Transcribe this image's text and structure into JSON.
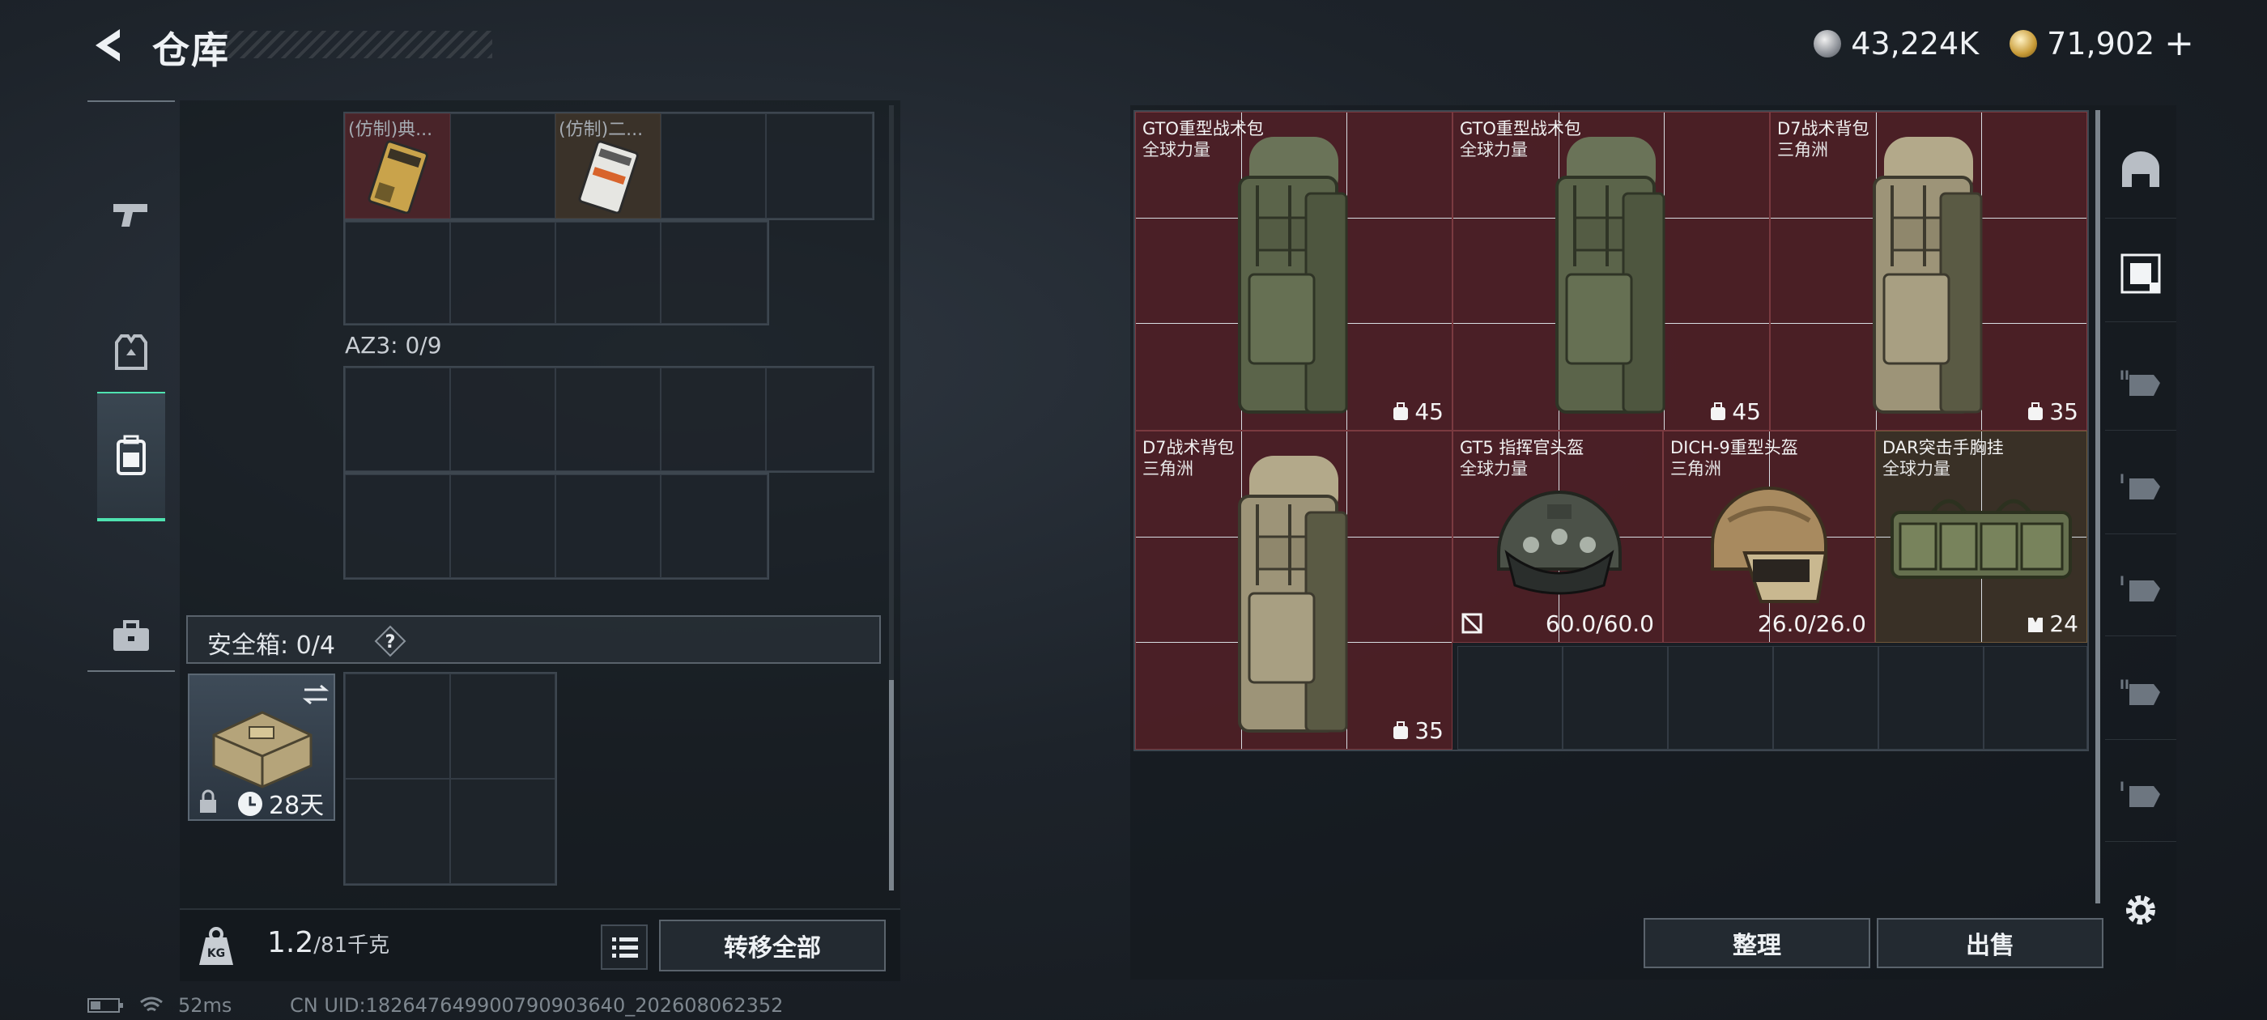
{
  "header": {
    "title": "仓库",
    "currency": [
      {
        "name": "silver-coin",
        "value": "43,224K"
      },
      {
        "name": "gold-coin",
        "value": "71,902"
      }
    ],
    "add_symbol": "+"
  },
  "side_nav": {
    "items": [
      {
        "icon": "pistol-icon",
        "active": false
      },
      {
        "icon": "armor-vest-icon",
        "active": false
      },
      {
        "icon": "backpack-icon",
        "active": true
      },
      {
        "icon": "briefcase-icon",
        "active": false
      }
    ]
  },
  "left_panel": {
    "top_items": [
      {
        "name": "(仿制)典..."
      },
      {
        "name": "(仿制)二..."
      }
    ],
    "az3_label": "AZ3: 0/9",
    "safe_box": {
      "label": "安全箱: 0/4",
      "help": "?",
      "days": "28天"
    },
    "weight_current": "1.2",
    "weight_max": "/81千克",
    "transfer_all": "转移全部"
  },
  "right_panel": {
    "items": [
      {
        "title": "GTO重型战术包",
        "subtitle": "全球力量",
        "value": "45",
        "type": "backpack",
        "tone": "red"
      },
      {
        "title": "GTO重型战术包",
        "subtitle": "全球力量",
        "value": "45",
        "type": "backpack",
        "tone": "red"
      },
      {
        "title": "D7战术背包",
        "subtitle": "三角洲",
        "value": "35",
        "type": "backpack-tan",
        "tone": "red"
      },
      {
        "title": "D7战术背包",
        "subtitle": "三角洲",
        "value": "35",
        "type": "backpack-tan",
        "tone": "red"
      },
      {
        "title": "GT5 指挥官头盔",
        "subtitle": "全球力量",
        "value": "60.0/60.0",
        "type": "helmet",
        "tone": "red"
      },
      {
        "title": "DICH-9重型头盔",
        "subtitle": "三角洲",
        "value": "26.0/26.0",
        "type": "helmet-tan",
        "tone": "red"
      },
      {
        "title": "DAR突击手胸挂",
        "subtitle": "全球力量",
        "value": "24",
        "type": "chest-rig",
        "tone": "tan"
      }
    ],
    "sort_label": "整理",
    "sell_label": "出售"
  },
  "right_nav": {
    "items": [
      "bunker-icon",
      "armor-slot-icon",
      "ii-hand-icon",
      "i-hand-icon",
      "i-hand-icon",
      "ii-hand-icon",
      "i-hand-icon"
    ]
  },
  "status": {
    "ping": "52ms",
    "uid": "CN UID:182647649900790903640_202608062352"
  }
}
